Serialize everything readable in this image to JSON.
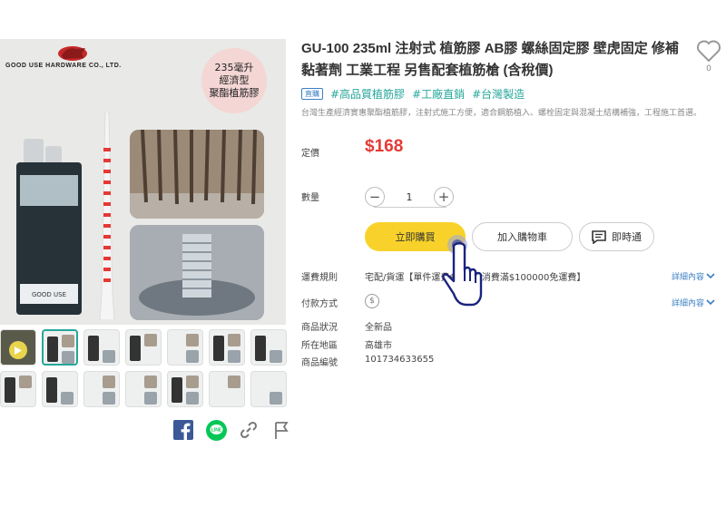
{
  "product": {
    "title": "GU-100 235ml 注射式 植筋膠 AB膠 螺絲固定膠 壁虎固定 修補黏著劑 工業工程 另售配套植筋槍 (含稅價)",
    "favorite_count": "0",
    "direct_badge": "直購",
    "tags": [
      "#高品質植筋膠",
      "#工廠直銷",
      "#台灣製造"
    ],
    "description": "台灣生產經濟實惠聚酯植筋膠，注射式施工方便，適合鋼筋植入、螺栓固定與混凝土結構補強，工程施工首選。",
    "price_label": "定價",
    "price": "$168",
    "quantity_label": "數量",
    "quantity": "1",
    "qty_minus": "−",
    "qty_plus": "+",
    "buy_now": "立即購買",
    "add_to_cart": "加入購物車",
    "chat": "即時通",
    "shipping_label": "運費規則",
    "shipping_value": "宅配/貨運【單件運費$120，消費滿$100000免運費】",
    "payment_label": "付款方式",
    "payment_symbol": "$",
    "more_details": "詳細內容",
    "condition_label": "商品狀況",
    "condition_value": "全新品",
    "location_label": "所在地區",
    "location_value": "高雄市",
    "id_label": "商品編號",
    "id_value": "101734633655"
  },
  "image": {
    "brand_text": "GOOD USE HARDWARE CO., LTD.",
    "promo_line1": "235毫升",
    "promo_line2": "經濟型",
    "promo_line3": "聚酯植筋膠",
    "cartridge_label": "GOOD USE"
  },
  "colors": {
    "price": "#e53935",
    "tag": "#26a69a",
    "buy_button": "#f8d22a",
    "link": "#3b7fc4",
    "facebook": "#3b5998",
    "line": "#06c755"
  },
  "icons": [
    "heart-icon",
    "chat-icon",
    "facebook-icon",
    "line-icon",
    "link-icon",
    "flag-icon",
    "chevron-down-icon",
    "hand-pointer-icon",
    "play-icon"
  ]
}
